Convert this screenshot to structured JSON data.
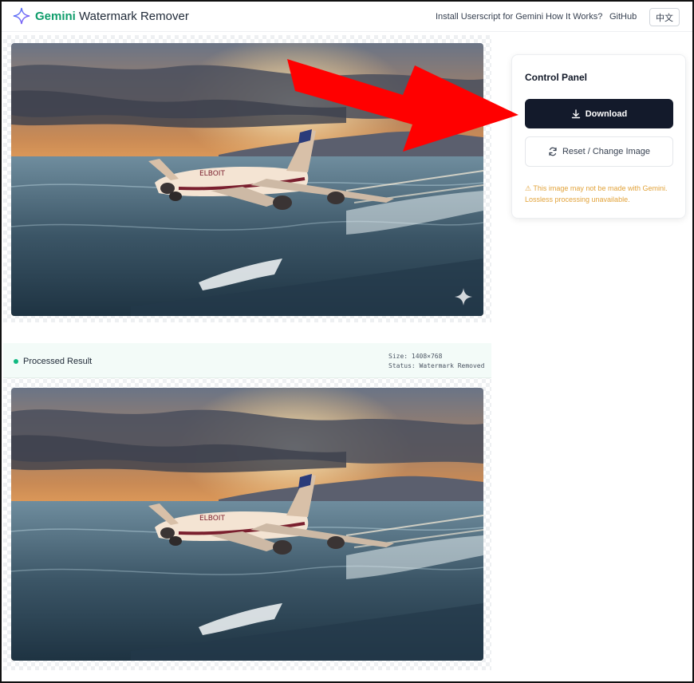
{
  "header": {
    "brand_accent": "Gemini",
    "brand_rest": " Watermark Remover",
    "nav": [
      "Install Userscript for Gemini",
      "How It Works?",
      "GitHub"
    ],
    "lang_button": "中文"
  },
  "result": {
    "title": "Processed Result",
    "size": "Size: 1408×768",
    "status": "Status: Watermark Removed"
  },
  "control_panel": {
    "title": "Control Panel",
    "download_label": "Download",
    "reset_label": "Reset / Change Image",
    "warning": "⚠ This image may not be made with Gemini. Lossless processing unavailable."
  },
  "icons": {
    "logo": "gemini-sparkle-icon",
    "download": "download-icon",
    "reset": "refresh-icon",
    "watermark": "sparkle-watermark-icon"
  },
  "colors": {
    "accent": "#0f9d6b",
    "download_bg": "#131a2b",
    "warning": "#e2a33b",
    "arrow": "#ff0000"
  }
}
